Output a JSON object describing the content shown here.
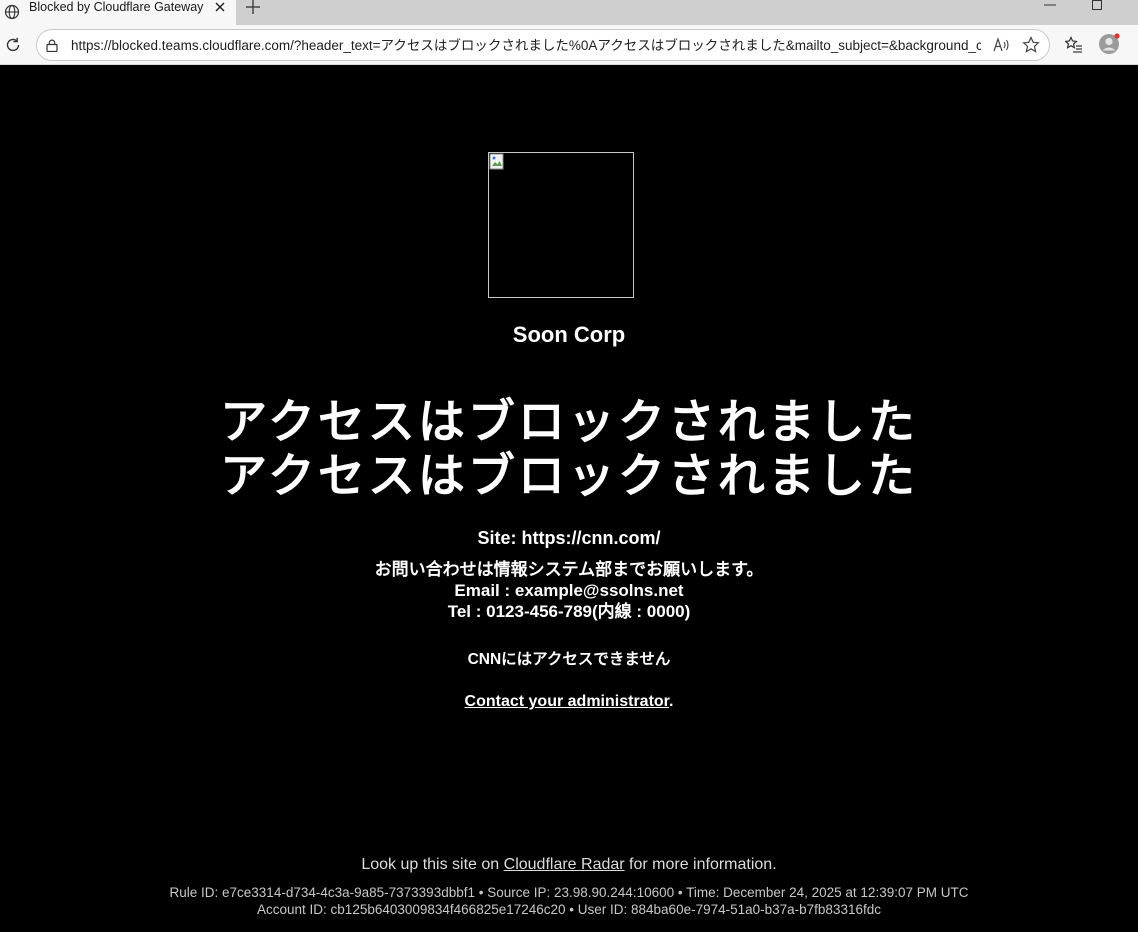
{
  "browser": {
    "tab_title": "Blocked by Cloudflare Gateway",
    "url": "https://blocked.teams.cloudflare.com/?header_text=アクセスはブロックされました%0Aアクセスはブロックされました&mailto_subject=&background_color=%..."
  },
  "page": {
    "org_name": "Soon Corp",
    "headline_line1": "アクセスはブロックされました",
    "headline_line2": "アクセスはブロックされました",
    "site": "Site: https://cnn.com/",
    "message_line1": "お問い合わせは情報システム部までお願いします。",
    "message_line2": "Email : example@ssolns.net",
    "message_line3": "Tel : 0123-456-789(内線 : 0000)",
    "cnn_notice": "CNNにはアクセスできません",
    "contact_link": "Contact your administrator",
    "contact_suffix": ".",
    "radar_prefix": "Look up this site on ",
    "radar_link": "Cloudflare Radar",
    "radar_suffix": " for more information.",
    "rule_line": "Rule ID: e7ce3314-d734-4c3a-9a85-7373393dbbf1 • Source IP: 23.98.90.244:10600 • Time: December 24, 2025 at 12:39:07 PM UTC",
    "account_line": "Account ID: cb125b6403009834f466825e17246c20 • User ID: 884ba60e-7974-51a0-b37a-b7fb83316fdc"
  },
  "colors": {
    "background": "#000000",
    "text": "#ffffff",
    "profile_dot": "#e0342f"
  }
}
